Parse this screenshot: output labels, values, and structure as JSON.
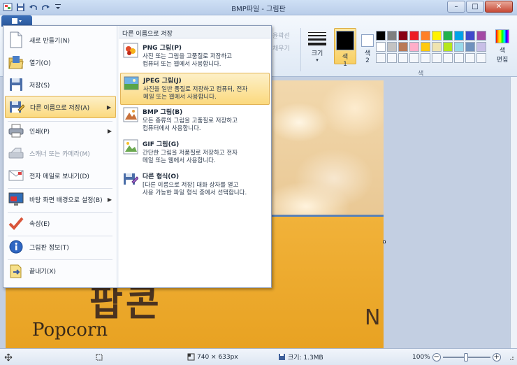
{
  "window": {
    "title": "BMP파일 - 그림판",
    "controls": {
      "minimize": "–",
      "maximize": "□",
      "close": "✕"
    }
  },
  "ribbon": {
    "outline_label": "윤곽선",
    "fill_label": "채우기",
    "size_label": "크기",
    "color1_label": "색 1",
    "color1_line1": "색",
    "color1_line2": "1",
    "color2_line1": "색",
    "color2_line2": "2",
    "edit_colors_line1": "색",
    "edit_colors_line2": "편집",
    "group_label": "색",
    "palette_row1": [
      "#000000",
      "#7f7f7f",
      "#880015",
      "#ed1c24",
      "#ff7f27",
      "#fff200",
      "#22b14c",
      "#00a2e8",
      "#3f48cc",
      "#a349a4"
    ],
    "palette_row2": [
      "#ffffff",
      "#c3c3c3",
      "#b97a57",
      "#ffaec9",
      "#ffc90e",
      "#efe4b0",
      "#b5e61d",
      "#99d9ea",
      "#7092be",
      "#c8bfe7"
    ]
  },
  "file_menu": {
    "items": [
      {
        "label": "새로 만들기(N)",
        "icon": "new-file-icon"
      },
      {
        "label": "열기(O)",
        "icon": "open-folder-icon"
      },
      {
        "label": "저장(S)",
        "icon": "save-icon"
      },
      {
        "label": "다른 이름으로 저장(A)",
        "icon": "save-as-icon",
        "selected": true,
        "submenu": true
      },
      {
        "label": "인쇄(P)",
        "icon": "printer-icon",
        "submenu": true
      },
      {
        "label": "스캐너 또는 카메라(M)",
        "icon": "scanner-icon",
        "disabled": true
      },
      {
        "label": "전자 메일로 보내기(D)",
        "icon": "email-icon"
      },
      {
        "label": "바탕 화면 배경으로 설정(B)",
        "icon": "desktop-background-icon",
        "submenu": true
      },
      {
        "label": "속성(E)",
        "icon": "checkmark-icon"
      },
      {
        "label": "그림판 정보(T)",
        "icon": "info-icon"
      },
      {
        "label": "끝내기(X)",
        "icon": "exit-icon"
      }
    ]
  },
  "save_as_submenu": {
    "header": "다른 이름으로 저장",
    "items": [
      {
        "title": "PNG 그림(P)",
        "desc1": "사진 또는 그림을 고품질로 저장하고",
        "desc2": "컴퓨터 또는 웹에서 사용합니다.",
        "icon": "png-image-icon"
      },
      {
        "title": "JPEG 그림(J)",
        "desc1": "사진을 일반 품질로 저장하고 컴퓨터, 전자",
        "desc2": "메일 또는 웹에서 사용합니다.",
        "icon": "jpeg-image-icon",
        "selected": true
      },
      {
        "title": "BMP 그림(B)",
        "desc1": "모든 종류의 그림을 고품질로 저장하고",
        "desc2": "컴퓨터에서 사용합니다.",
        "icon": "bmp-image-icon"
      },
      {
        "title": "GIF 그림(G)",
        "desc1": "간단한 그림을 저품질로 저장하고 전자",
        "desc2": "메일 또는 웹에서 사용합니다.",
        "icon": "gif-image-icon"
      },
      {
        "title": "다른 형식(O)",
        "desc1": "[다른 이름으로 저장] 대화 상자를 열고",
        "desc2": "사용 가능한 파일 형식 중에서 선택합니다.",
        "icon": "other-format-icon"
      }
    ]
  },
  "canvas": {
    "photo_text_korean": "팝콘",
    "photo_text_english": "Popcorn",
    "photo_text_side": "N"
  },
  "statusbar": {
    "dimensions": "740 × 633px",
    "file_size": "크기: 1.3MB",
    "zoom": "100%",
    "zoom_level_percent": 100
  }
}
